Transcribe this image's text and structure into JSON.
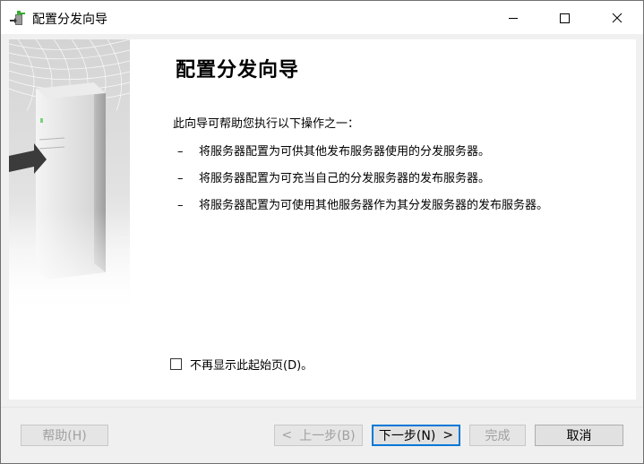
{
  "window": {
    "title": "配置分发向导"
  },
  "main": {
    "heading": "配置分发向导",
    "intro": "此向导可帮助您执行以下操作之一：",
    "bullets": [
      {
        "dash": "–",
        "text": "将服务器配置为可供其他发布服务器使用的分发服务器。"
      },
      {
        "dash": "–",
        "text": "将服务器配置为可充当自己的分发服务器的发布服务器。"
      },
      {
        "dash": "–",
        "text": "将服务器配置为可使用其他服务器作为其分发服务器的发布服务器。"
      }
    ],
    "checkbox_label": "不再显示此起始页(D)。",
    "checkbox_checked": false
  },
  "buttons": {
    "help": "帮助(H)",
    "back_arrow": "<",
    "back": "上一步(B)",
    "next": "下一步(N)",
    "next_arrow": ">",
    "finish": "完成",
    "cancel": "取消"
  },
  "icons": {
    "app": "wizard-server-icon",
    "minimize": "minimize-icon",
    "maximize": "maximize-icon",
    "close": "close-icon"
  },
  "colors": {
    "focus_border": "#0078d7",
    "disabled_text": "#a0a0a0"
  }
}
